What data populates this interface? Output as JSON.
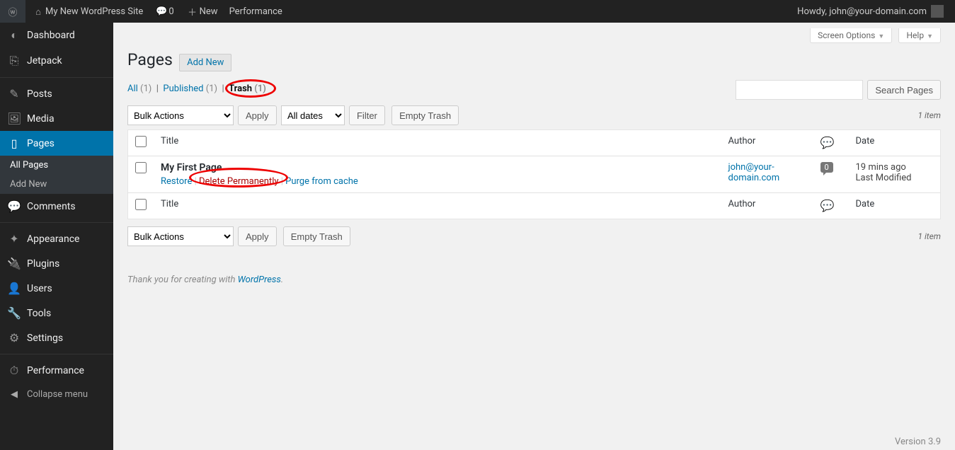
{
  "adminbar": {
    "site_name": "My New WordPress Site",
    "comments_count": "0",
    "new_label": "New",
    "performance_label": "Performance",
    "howdy": "Howdy, john@your-domain.com"
  },
  "sidebar": {
    "items": [
      {
        "icon": "◐",
        "label": "Dashboard",
        "key": "dashboard"
      },
      {
        "icon": "⎘",
        "label": "Jetpack",
        "key": "jetpack"
      },
      {
        "icon": "✎",
        "label": "Posts",
        "key": "posts"
      },
      {
        "icon": "🖼",
        "label": "Media",
        "key": "media"
      },
      {
        "icon": "▯",
        "label": "Pages",
        "key": "pages",
        "current": true
      },
      {
        "icon": "💬",
        "label": "Comments",
        "key": "comments"
      },
      {
        "icon": "✦",
        "label": "Appearance",
        "key": "appearance"
      },
      {
        "icon": "🔌",
        "label": "Plugins",
        "key": "plugins"
      },
      {
        "icon": "👤",
        "label": "Users",
        "key": "users"
      },
      {
        "icon": "🔧",
        "label": "Tools",
        "key": "tools"
      },
      {
        "icon": "⚙",
        "label": "Settings",
        "key": "settings"
      },
      {
        "icon": "⏱",
        "label": "Performance",
        "key": "performance"
      }
    ],
    "submenu_pages": [
      {
        "label": "All Pages",
        "current": true
      },
      {
        "label": "Add New"
      }
    ],
    "collapse_label": "Collapse menu"
  },
  "screen_meta": {
    "screen_options": "Screen Options",
    "help": "Help"
  },
  "heading": "Pages",
  "add_new": "Add New",
  "filters": {
    "all": "All",
    "all_count": "(1)",
    "published": "Published",
    "published_count": "(1)",
    "trash": "Trash",
    "trash_count": "(1)"
  },
  "search_button": "Search Pages",
  "bulk_actions": "Bulk Actions",
  "apply": "Apply",
  "all_dates": "All dates",
  "filter": "Filter",
  "empty_trash": "Empty Trash",
  "items_count": "1 item",
  "columns": {
    "title": "Title",
    "author": "Author",
    "date": "Date"
  },
  "row": {
    "title": "My First Page",
    "actions": {
      "restore": "Restore",
      "delete": "Delete Permanently",
      "purge": "Purge from cache"
    },
    "author": "john@your-domain.com",
    "comments": "0",
    "date_line1": "19 mins ago",
    "date_line2": "Last Modified"
  },
  "footer": {
    "thanks": "Thank you for creating with ",
    "wp": "WordPress",
    "version": "Version 3.9"
  }
}
